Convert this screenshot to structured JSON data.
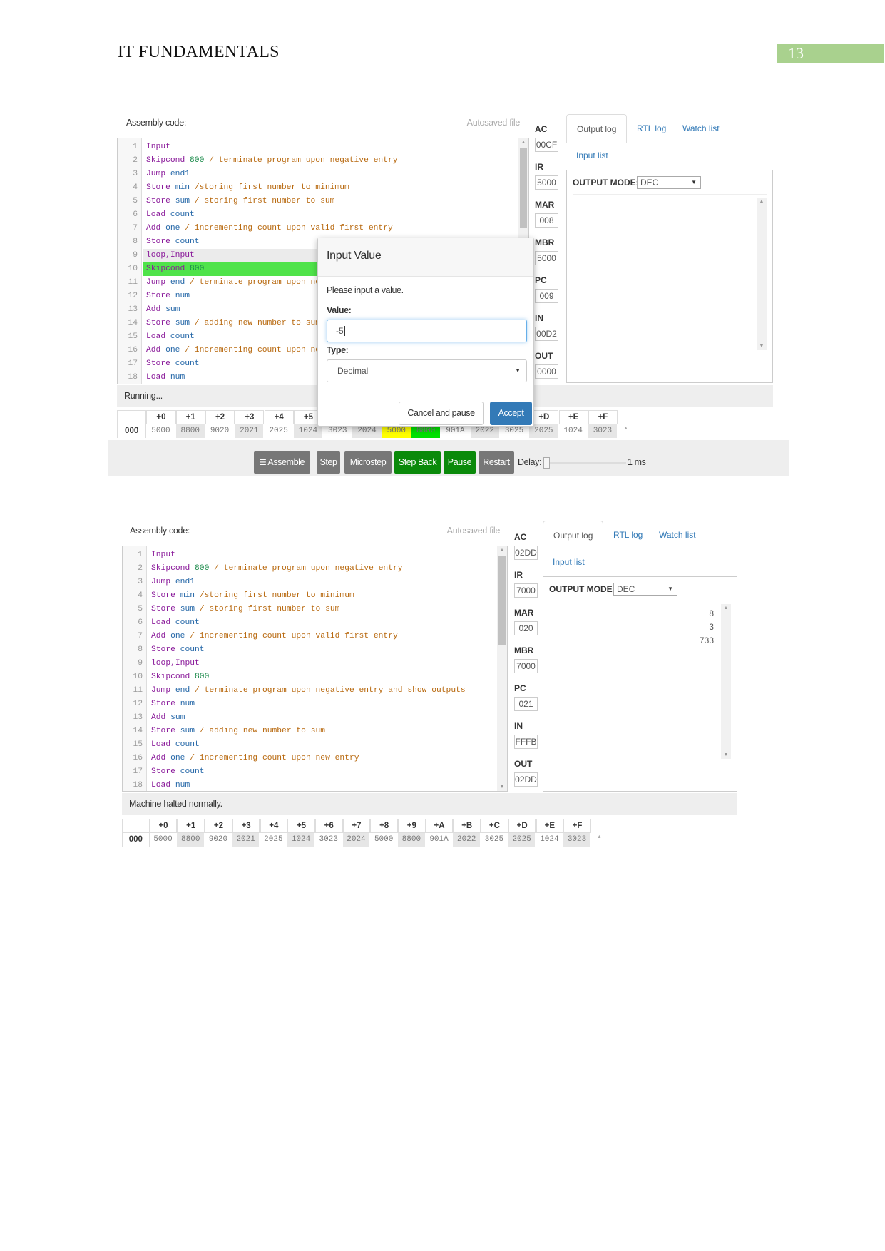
{
  "document": {
    "header_title": "IT FUNDAMENTALS",
    "page_number": "13",
    "accent_color": "#a9d18e"
  },
  "code_lines": [
    "Input",
    "Skipcond 800 / terminate program upon negative entry",
    "Jump end1",
    "Store min /storing first number to minimum",
    "Store sum / storing first number to sum",
    "Load count",
    "Add one / incrementing count upon valid first entry",
    "Store count",
    "loop,Input",
    "Skipcond 800",
    "Jump end / terminate program upon negative entry and show outputs",
    "Store num",
    "Add sum",
    "Store sum / adding new number to sum",
    "Load count",
    "Add one / incrementing count upon new entry",
    "Store count",
    "Load num"
  ],
  "memory_headers": [
    "+0",
    "+1",
    "+2",
    "+3",
    "+4",
    "+5",
    "+6",
    "+7",
    "+8",
    "+9",
    "+A",
    "+B",
    "+C",
    "+D",
    "+E",
    "+F"
  ],
  "panels": [
    {
      "assembly_label": "Assembly code:",
      "autosave_label": "Autosaved file",
      "highlight": {
        "current_line": 10,
        "current_line_color": "#4fe34a",
        "previous_line": 9
      },
      "registers": [
        {
          "name": "AC",
          "value": "00CF"
        },
        {
          "name": "IR",
          "value": "5000"
        },
        {
          "name": "MAR",
          "value": "008"
        },
        {
          "name": "MBR",
          "value": "5000"
        },
        {
          "name": "PC",
          "value": "009"
        },
        {
          "name": "IN",
          "value": "00D2"
        },
        {
          "name": "OUT",
          "value": "0000"
        }
      ],
      "tabs": [
        "Output log",
        "RTL log",
        "Watch list",
        "Input list"
      ],
      "output_mode_label": "OUTPUT MODE:",
      "output_mode": "DEC",
      "output_values": [],
      "status": "Running...",
      "memory_row": {
        "address": "000",
        "values": [
          "5000",
          "8800",
          "9020",
          "2021",
          "2025",
          "1024",
          "3023",
          "2024",
          "5000",
          "8800",
          "901A",
          "2022",
          "3025",
          "2025",
          "1024",
          "3023"
        ],
        "highlight_mar": 8,
        "highlight_pc": 9
      },
      "toolbar": {
        "buttons": [
          "Assemble",
          "Step",
          "Microstep",
          "Step Back",
          "Pause",
          "Restart"
        ],
        "delay_label": "Delay:",
        "delay_value": "1 ms",
        "delay_fraction": 0
      },
      "dialog": {
        "title": "Input Value",
        "prompt": "Please input a value.",
        "value_label": "Value:",
        "value": "-5",
        "type_label": "Type:",
        "type_value": "Decimal",
        "cancel_label": "Cancel and pause",
        "accept_label": "Accept"
      }
    },
    {
      "assembly_label": "Assembly code:",
      "autosave_label": "Autosaved file",
      "registers": [
        {
          "name": "AC",
          "value": "02DD"
        },
        {
          "name": "IR",
          "value": "7000"
        },
        {
          "name": "MAR",
          "value": "020"
        },
        {
          "name": "MBR",
          "value": "7000"
        },
        {
          "name": "PC",
          "value": "021"
        },
        {
          "name": "IN",
          "value": "FFFB"
        },
        {
          "name": "OUT",
          "value": "02DD"
        }
      ],
      "tabs": [
        "Output log",
        "RTL log",
        "Watch list",
        "Input list"
      ],
      "output_mode_label": "OUTPUT MODE:",
      "output_mode": "DEC",
      "output_values": [
        "8",
        "3",
        "733"
      ],
      "status": "Machine halted normally.",
      "memory_row": {
        "address": "000",
        "values": [
          "5000",
          "8800",
          "9020",
          "2021",
          "2025",
          "1024",
          "3023",
          "2024",
          "5000",
          "8800",
          "901A",
          "2022",
          "3025",
          "2025",
          "1024",
          "3023"
        ]
      }
    }
  ]
}
